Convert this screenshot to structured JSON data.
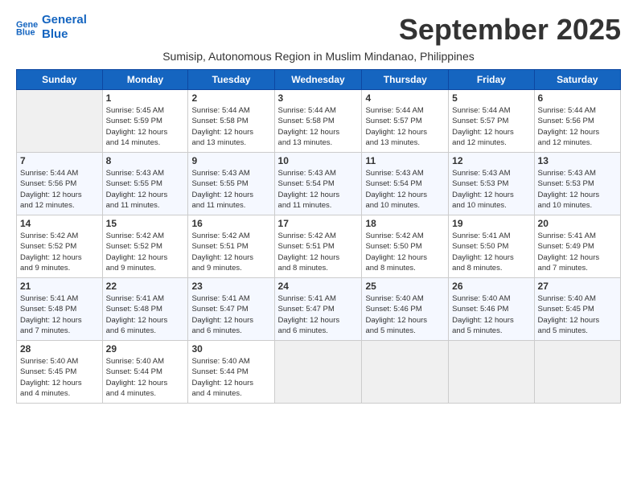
{
  "logo": {
    "line1": "General",
    "line2": "Blue"
  },
  "title": "September 2025",
  "subtitle": "Sumisip, Autonomous Region in Muslim Mindanao, Philippines",
  "days_of_week": [
    "Sunday",
    "Monday",
    "Tuesday",
    "Wednesday",
    "Thursday",
    "Friday",
    "Saturday"
  ],
  "weeks": [
    [
      {
        "day": "",
        "info": ""
      },
      {
        "day": "1",
        "info": "Sunrise: 5:45 AM\nSunset: 5:59 PM\nDaylight: 12 hours\nand 14 minutes."
      },
      {
        "day": "2",
        "info": "Sunrise: 5:44 AM\nSunset: 5:58 PM\nDaylight: 12 hours\nand 13 minutes."
      },
      {
        "day": "3",
        "info": "Sunrise: 5:44 AM\nSunset: 5:58 PM\nDaylight: 12 hours\nand 13 minutes."
      },
      {
        "day": "4",
        "info": "Sunrise: 5:44 AM\nSunset: 5:57 PM\nDaylight: 12 hours\nand 13 minutes."
      },
      {
        "day": "5",
        "info": "Sunrise: 5:44 AM\nSunset: 5:57 PM\nDaylight: 12 hours\nand 12 minutes."
      },
      {
        "day": "6",
        "info": "Sunrise: 5:44 AM\nSunset: 5:56 PM\nDaylight: 12 hours\nand 12 minutes."
      }
    ],
    [
      {
        "day": "7",
        "info": "Sunrise: 5:44 AM\nSunset: 5:56 PM\nDaylight: 12 hours\nand 12 minutes."
      },
      {
        "day": "8",
        "info": "Sunrise: 5:43 AM\nSunset: 5:55 PM\nDaylight: 12 hours\nand 11 minutes."
      },
      {
        "day": "9",
        "info": "Sunrise: 5:43 AM\nSunset: 5:55 PM\nDaylight: 12 hours\nand 11 minutes."
      },
      {
        "day": "10",
        "info": "Sunrise: 5:43 AM\nSunset: 5:54 PM\nDaylight: 12 hours\nand 11 minutes."
      },
      {
        "day": "11",
        "info": "Sunrise: 5:43 AM\nSunset: 5:54 PM\nDaylight: 12 hours\nand 10 minutes."
      },
      {
        "day": "12",
        "info": "Sunrise: 5:43 AM\nSunset: 5:53 PM\nDaylight: 12 hours\nand 10 minutes."
      },
      {
        "day": "13",
        "info": "Sunrise: 5:43 AM\nSunset: 5:53 PM\nDaylight: 12 hours\nand 10 minutes."
      }
    ],
    [
      {
        "day": "14",
        "info": "Sunrise: 5:42 AM\nSunset: 5:52 PM\nDaylight: 12 hours\nand 9 minutes."
      },
      {
        "day": "15",
        "info": "Sunrise: 5:42 AM\nSunset: 5:52 PM\nDaylight: 12 hours\nand 9 minutes."
      },
      {
        "day": "16",
        "info": "Sunrise: 5:42 AM\nSunset: 5:51 PM\nDaylight: 12 hours\nand 9 minutes."
      },
      {
        "day": "17",
        "info": "Sunrise: 5:42 AM\nSunset: 5:51 PM\nDaylight: 12 hours\nand 8 minutes."
      },
      {
        "day": "18",
        "info": "Sunrise: 5:42 AM\nSunset: 5:50 PM\nDaylight: 12 hours\nand 8 minutes."
      },
      {
        "day": "19",
        "info": "Sunrise: 5:41 AM\nSunset: 5:50 PM\nDaylight: 12 hours\nand 8 minutes."
      },
      {
        "day": "20",
        "info": "Sunrise: 5:41 AM\nSunset: 5:49 PM\nDaylight: 12 hours\nand 7 minutes."
      }
    ],
    [
      {
        "day": "21",
        "info": "Sunrise: 5:41 AM\nSunset: 5:48 PM\nDaylight: 12 hours\nand 7 minutes."
      },
      {
        "day": "22",
        "info": "Sunrise: 5:41 AM\nSunset: 5:48 PM\nDaylight: 12 hours\nand 6 minutes."
      },
      {
        "day": "23",
        "info": "Sunrise: 5:41 AM\nSunset: 5:47 PM\nDaylight: 12 hours\nand 6 minutes."
      },
      {
        "day": "24",
        "info": "Sunrise: 5:41 AM\nSunset: 5:47 PM\nDaylight: 12 hours\nand 6 minutes."
      },
      {
        "day": "25",
        "info": "Sunrise: 5:40 AM\nSunset: 5:46 PM\nDaylight: 12 hours\nand 5 minutes."
      },
      {
        "day": "26",
        "info": "Sunrise: 5:40 AM\nSunset: 5:46 PM\nDaylight: 12 hours\nand 5 minutes."
      },
      {
        "day": "27",
        "info": "Sunrise: 5:40 AM\nSunset: 5:45 PM\nDaylight: 12 hours\nand 5 minutes."
      }
    ],
    [
      {
        "day": "28",
        "info": "Sunrise: 5:40 AM\nSunset: 5:45 PM\nDaylight: 12 hours\nand 4 minutes."
      },
      {
        "day": "29",
        "info": "Sunrise: 5:40 AM\nSunset: 5:44 PM\nDaylight: 12 hours\nand 4 minutes."
      },
      {
        "day": "30",
        "info": "Sunrise: 5:40 AM\nSunset: 5:44 PM\nDaylight: 12 hours\nand 4 minutes."
      },
      {
        "day": "",
        "info": ""
      },
      {
        "day": "",
        "info": ""
      },
      {
        "day": "",
        "info": ""
      },
      {
        "day": "",
        "info": ""
      }
    ]
  ]
}
